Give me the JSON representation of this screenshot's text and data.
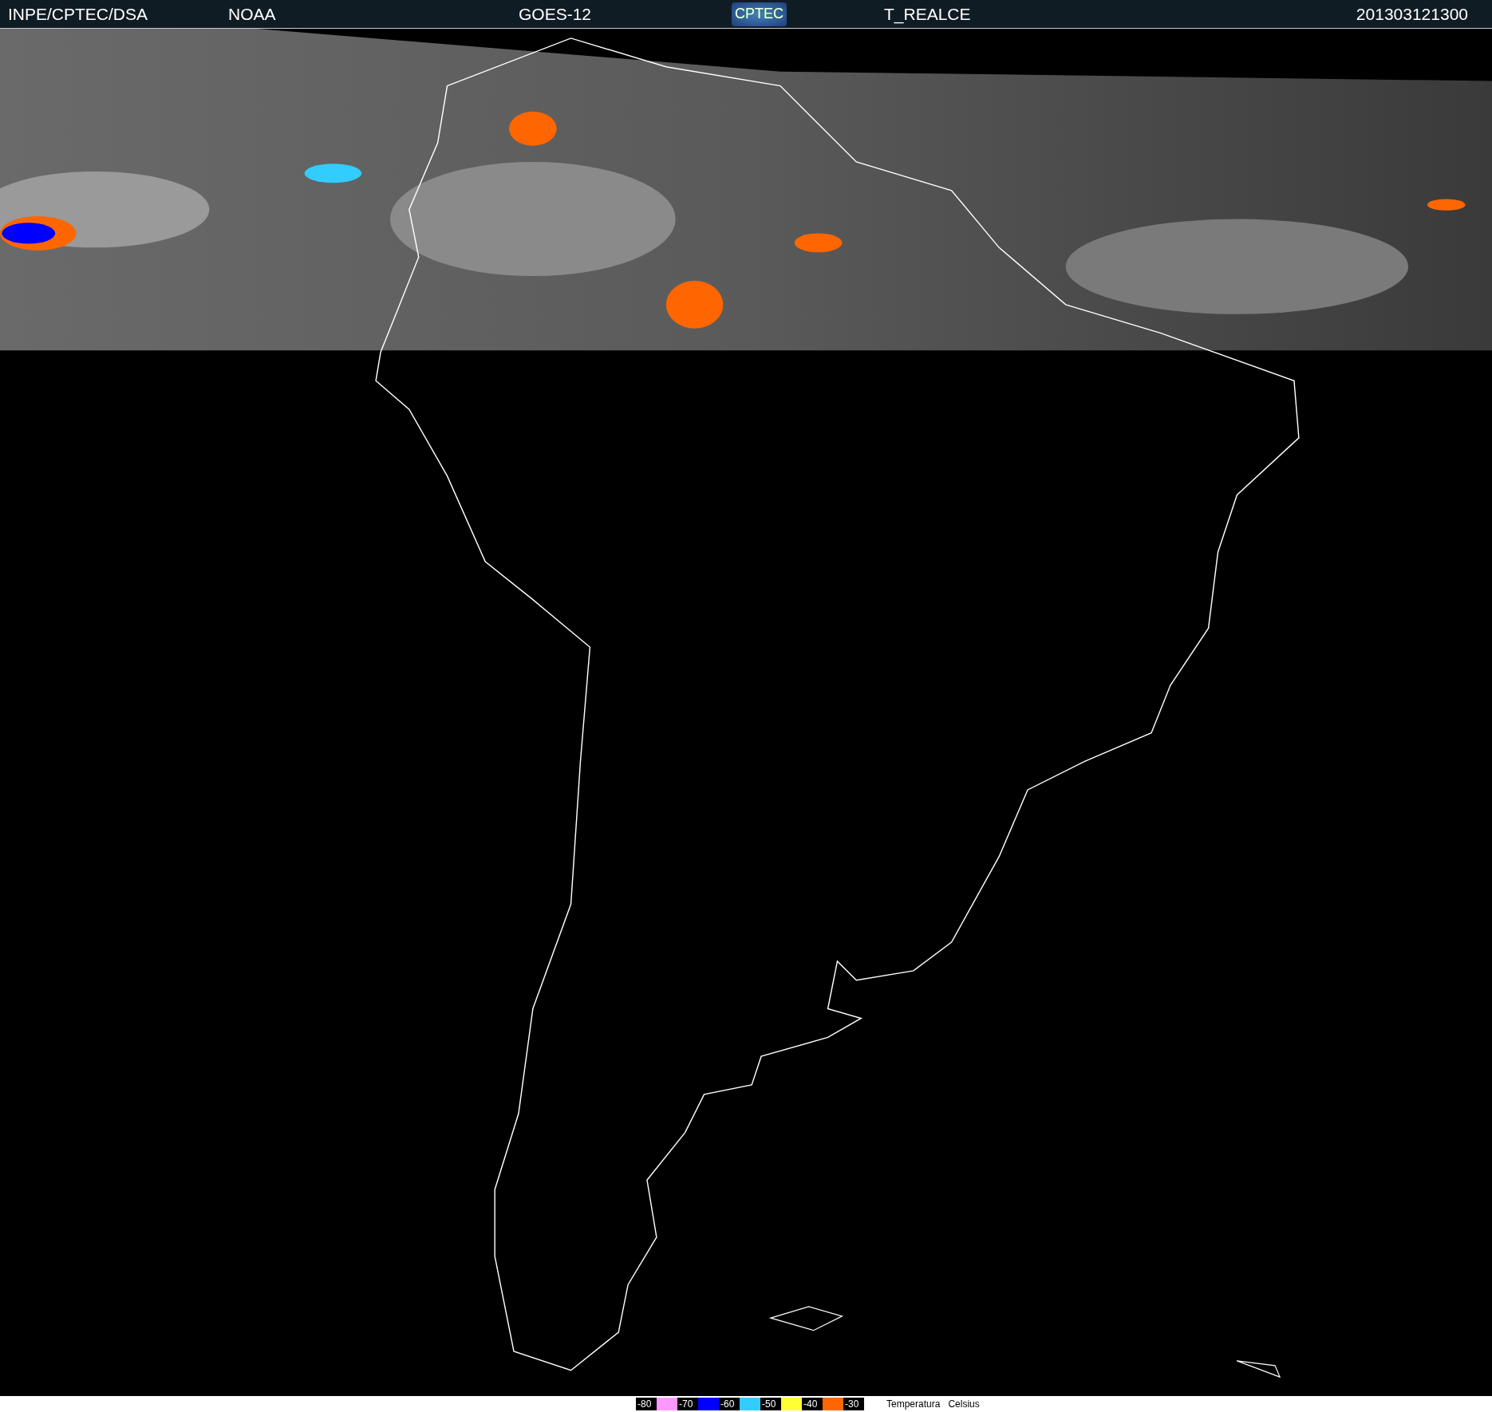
{
  "header": {
    "items": [
      {
        "kind": "text",
        "text": "INPE/CPTEC/DSA"
      },
      {
        "kind": "text",
        "text": "NOAA"
      },
      {
        "kind": "text",
        "text": "GOES-12"
      },
      {
        "kind": "logo",
        "text": "CPTEC"
      },
      {
        "kind": "text",
        "text": "T_REALCE"
      },
      {
        "kind": "text",
        "text": "201303121300"
      }
    ]
  },
  "legend": {
    "items": [
      {
        "kind": "value",
        "text": "-80"
      },
      {
        "kind": "swatch",
        "color": "#ff99ff"
      },
      {
        "kind": "value",
        "text": "-70"
      },
      {
        "kind": "swatch",
        "color": "#0000ff"
      },
      {
        "kind": "value",
        "text": "-60"
      },
      {
        "kind": "swatch",
        "color": "#33ccff"
      },
      {
        "kind": "value",
        "text": "-50"
      },
      {
        "kind": "swatch",
        "color": "#ffff33"
      },
      {
        "kind": "value",
        "text": "-40"
      },
      {
        "kind": "swatch",
        "color": "#ff6600"
      },
      {
        "kind": "value",
        "text": "-30"
      }
    ],
    "title": "Temperatura",
    "unit": "Celsius"
  }
}
